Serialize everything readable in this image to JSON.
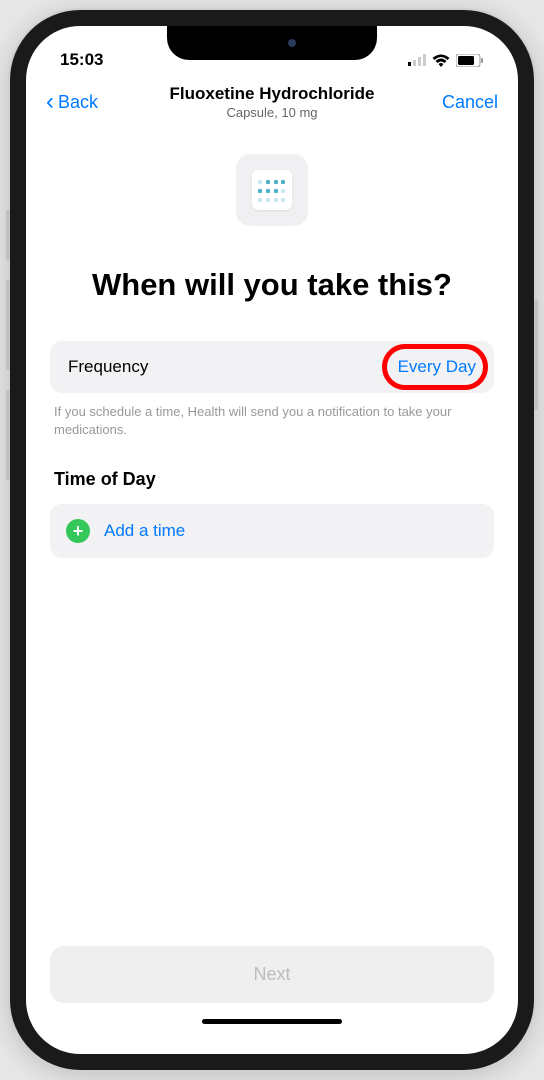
{
  "status": {
    "time": "15:03"
  },
  "nav": {
    "back_label": "Back",
    "title": "Fluoxetine Hydrochloride",
    "subtitle": "Capsule, 10 mg",
    "cancel_label": "Cancel"
  },
  "heading": "When will you take this?",
  "frequency": {
    "label": "Frequency",
    "value": "Every Day"
  },
  "hint": "If you schedule a time, Health will send you a notification to take your medications.",
  "time_section": {
    "title": "Time of Day",
    "add_label": "Add a time"
  },
  "next_label": "Next"
}
